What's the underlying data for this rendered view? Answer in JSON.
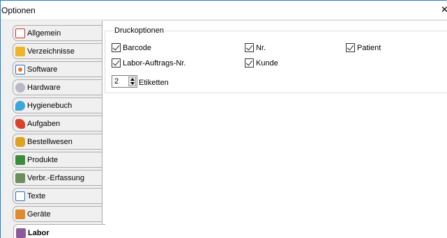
{
  "window": {
    "title": "Optionen",
    "close_symbol": "✕"
  },
  "tabs": [
    {
      "label": "Allgemein",
      "icon": "checklist-icon",
      "color": "#c9302c"
    },
    {
      "label": "Verzeichnisse",
      "icon": "folder-icon",
      "color": "#f0b429"
    },
    {
      "label": "Software",
      "icon": "software-icon",
      "color": "#e87722"
    },
    {
      "label": "Hardware",
      "icon": "gear-icon",
      "color": "#8a8aa0"
    },
    {
      "label": "Hygienebuch",
      "icon": "pin-icon",
      "color": "#3aa7d8"
    },
    {
      "label": "Aufgaben",
      "icon": "tasks-icon",
      "color": "#d9412b"
    },
    {
      "label": "Bestellwesen",
      "icon": "order-icon",
      "color": "#e0a020"
    },
    {
      "label": "Produkte",
      "icon": "product-icon",
      "color": "#3c8c3c"
    },
    {
      "label": "Verbr.-Erfassung",
      "icon": "scale-icon",
      "color": "#6b8e5a"
    },
    {
      "label": "Texte",
      "icon": "text-icon",
      "color": "#2d6fb7"
    },
    {
      "label": "Geräte",
      "icon": "device-icon",
      "color": "#e08a2c"
    },
    {
      "label": "Labor",
      "icon": "lab-icon",
      "color": "#8a5a9a",
      "active": true
    }
  ],
  "druckoptionen": {
    "group_label": "Druckoptionen",
    "checkboxes": [
      {
        "label": "Barcode",
        "checked": true
      },
      {
        "label": "Nr.",
        "checked": true
      },
      {
        "label": "Patient",
        "checked": true
      },
      {
        "label": "Labor-Auftrags-Nr.",
        "checked": true
      },
      {
        "label": "Kunde",
        "checked": true
      }
    ],
    "etiketten": {
      "value": "2",
      "label": "Etiketten"
    }
  }
}
